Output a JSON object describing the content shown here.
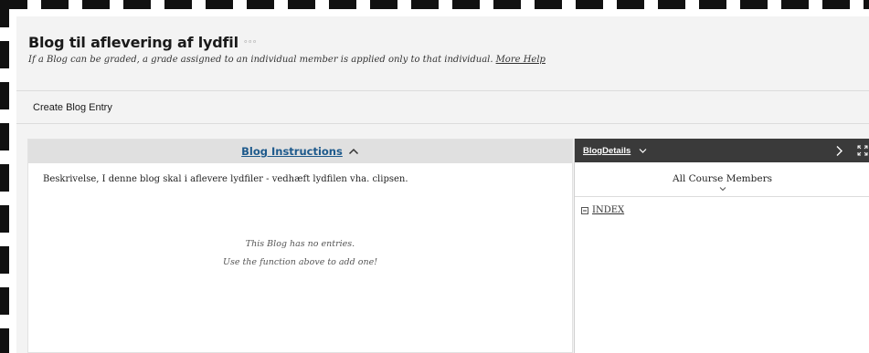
{
  "header": {
    "title": "Blog til aflevering af lydfil",
    "more_icon": "more-options-icon",
    "subtitle": "If a Blog can be graded, a grade assigned to an individual member is applied only to that individual.",
    "help_link": "More Help"
  },
  "action_bar": {
    "create_entry": "Create Blog Entry"
  },
  "instructions": {
    "label": "Blog Instructions",
    "toggle_icon": "chevron-up-icon",
    "description": "Beskrivelse, I denne blog skal i aflevere lydfiler - vedhæft lydfilen vha. clipsen."
  },
  "empty_state": {
    "line1": "This Blog has no entries.",
    "line2": "Use the function above to add one!"
  },
  "details": {
    "label": "BlogDetails",
    "members_select": "All Course Members",
    "index_label": "INDEX"
  },
  "colors": {
    "instructions_link": "#1e5a8c",
    "details_bar": "#3a3a3a",
    "page_background": "#f3f3f3"
  }
}
